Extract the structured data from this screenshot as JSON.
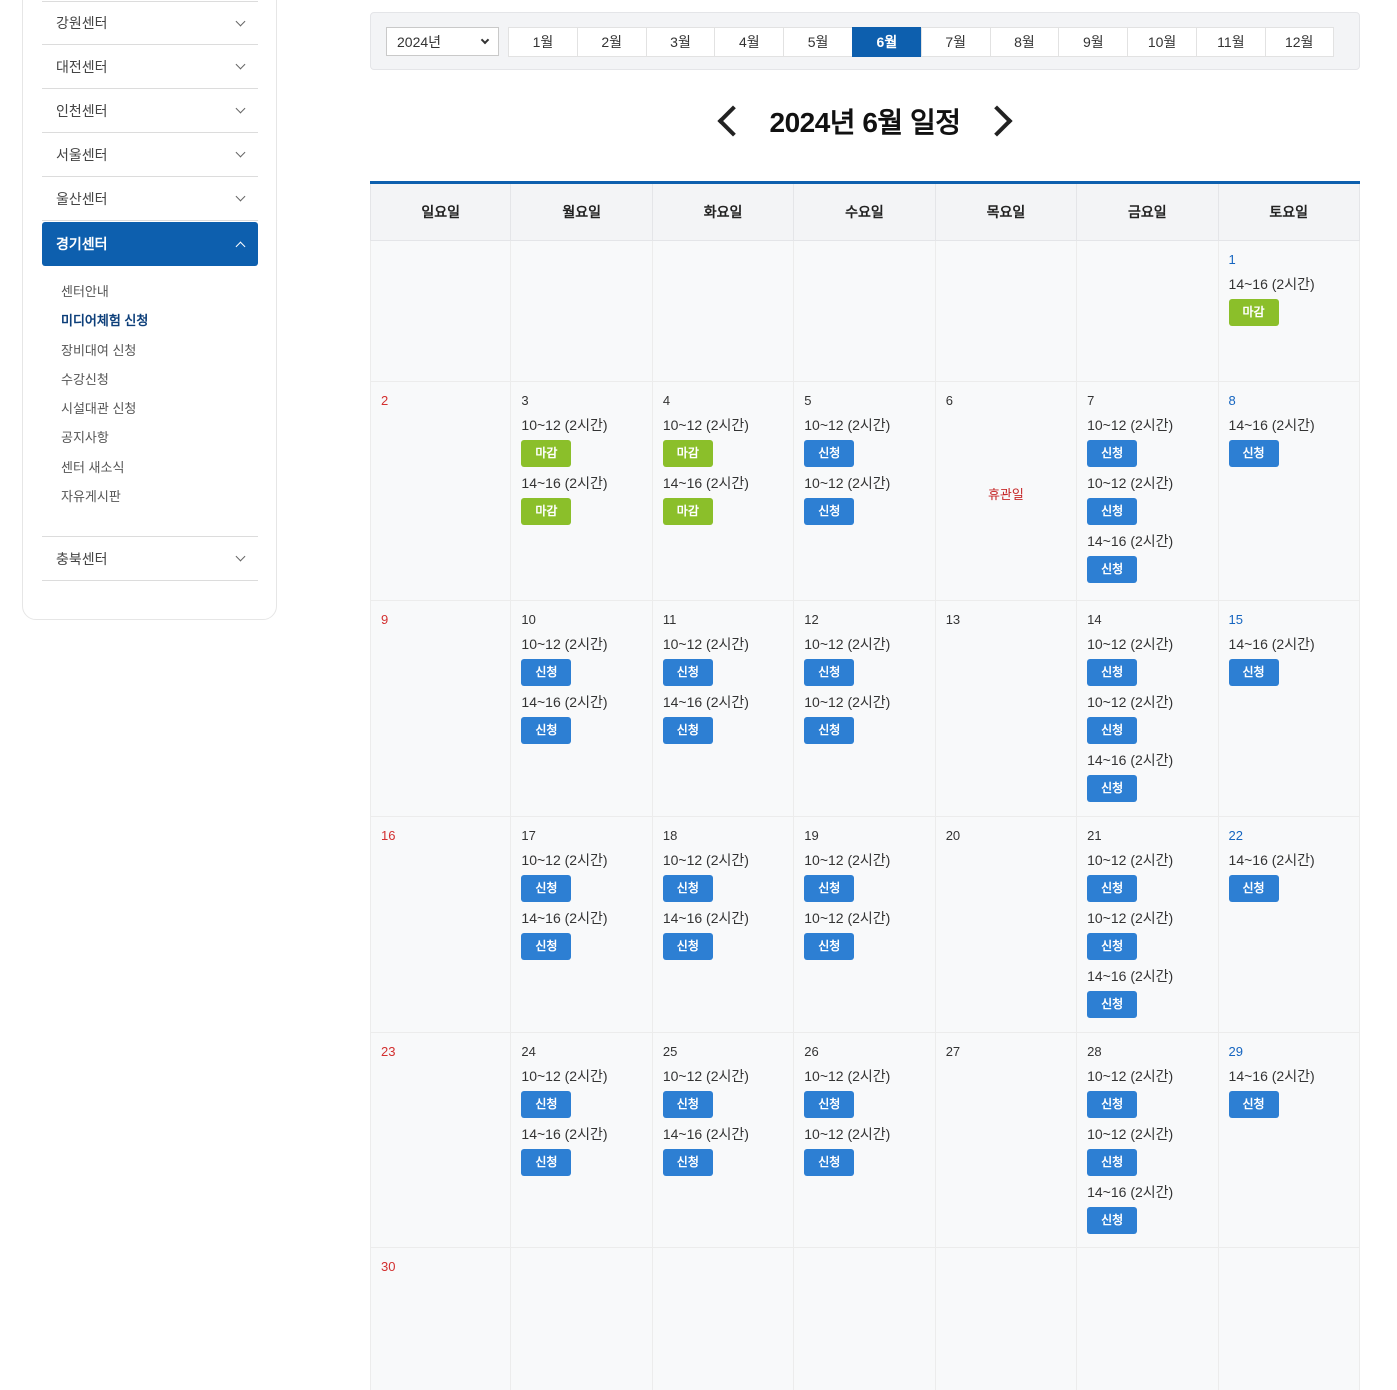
{
  "sidebar": {
    "centers_top": [
      "강원센터",
      "대전센터",
      "인천센터",
      "서울센터",
      "울산센터"
    ],
    "active_center": "경기센터",
    "sub_items": [
      "센터안내",
      "미디어체험 신청",
      "장비대여 신청",
      "수강신청",
      "시설대관 신청",
      "공지사항",
      "센터 새소식",
      "자유게시판"
    ],
    "current_sub": "미디어체험 신청",
    "centers_bottom": [
      "충북센터"
    ]
  },
  "monthbar": {
    "year": "2024년",
    "months": [
      "1월",
      "2월",
      "3월",
      "4월",
      "5월",
      "6월",
      "7월",
      "8월",
      "9월",
      "10월",
      "11월",
      "12월"
    ],
    "active_month": "6월"
  },
  "calendar": {
    "title": "2024년 6월 일정",
    "weekdays": [
      "일요일",
      "월요일",
      "화요일",
      "수요일",
      "목요일",
      "금요일",
      "토요일"
    ],
    "holiday_label": "휴관일",
    "rows": [
      {
        "height": 141,
        "cells": [
          null,
          null,
          null,
          null,
          null,
          null,
          {
            "day": "1",
            "slots": [
              {
                "time": "14~16 (2시간)",
                "status": "마감"
              }
            ]
          }
        ]
      },
      {
        "height": 219,
        "cells": [
          {
            "day": "2",
            "slots": []
          },
          {
            "day": "3",
            "slots": [
              {
                "time": "10~12 (2시간)",
                "status": "마감"
              },
              {
                "time": "14~16 (2시간)",
                "status": "마감"
              }
            ]
          },
          {
            "day": "4",
            "slots": [
              {
                "time": "10~12 (2시간)",
                "status": "마감"
              },
              {
                "time": "14~16 (2시간)",
                "status": "마감"
              }
            ]
          },
          {
            "day": "5",
            "slots": [
              {
                "time": "10~12 (2시간)",
                "status": "신청"
              },
              {
                "time": "10~12 (2시간)",
                "status": "신청"
              }
            ]
          },
          {
            "day": "6",
            "slots": [],
            "holiday": true
          },
          {
            "day": "7",
            "slots": [
              {
                "time": "10~12 (2시간)",
                "status": "신청"
              },
              {
                "time": "10~12 (2시간)",
                "status": "신청"
              },
              {
                "time": "14~16 (2시간)",
                "status": "신청"
              }
            ]
          },
          {
            "day": "8",
            "slots": [
              {
                "time": "14~16 (2시간)",
                "status": "신청"
              }
            ]
          }
        ]
      },
      {
        "height": 216,
        "cells": [
          {
            "day": "9",
            "slots": []
          },
          {
            "day": "10",
            "slots": [
              {
                "time": "10~12 (2시간)",
                "status": "신청"
              },
              {
                "time": "14~16 (2시간)",
                "status": "신청"
              }
            ]
          },
          {
            "day": "11",
            "slots": [
              {
                "time": "10~12 (2시간)",
                "status": "신청"
              },
              {
                "time": "14~16 (2시간)",
                "status": "신청"
              }
            ]
          },
          {
            "day": "12",
            "slots": [
              {
                "time": "10~12 (2시간)",
                "status": "신청"
              },
              {
                "time": "10~12 (2시간)",
                "status": "신청"
              }
            ]
          },
          {
            "day": "13",
            "slots": []
          },
          {
            "day": "14",
            "slots": [
              {
                "time": "10~12 (2시간)",
                "status": "신청"
              },
              {
                "time": "10~12 (2시간)",
                "status": "신청"
              },
              {
                "time": "14~16 (2시간)",
                "status": "신청"
              }
            ]
          },
          {
            "day": "15",
            "slots": [
              {
                "time": "14~16 (2시간)",
                "status": "신청"
              }
            ]
          }
        ]
      },
      {
        "height": 216,
        "cells": [
          {
            "day": "16",
            "slots": []
          },
          {
            "day": "17",
            "slots": [
              {
                "time": "10~12 (2시간)",
                "status": "신청"
              },
              {
                "time": "14~16 (2시간)",
                "status": "신청"
              }
            ]
          },
          {
            "day": "18",
            "slots": [
              {
                "time": "10~12 (2시간)",
                "status": "신청"
              },
              {
                "time": "14~16 (2시간)",
                "status": "신청"
              }
            ]
          },
          {
            "day": "19",
            "slots": [
              {
                "time": "10~12 (2시간)",
                "status": "신청"
              },
              {
                "time": "10~12 (2시간)",
                "status": "신청"
              }
            ]
          },
          {
            "day": "20",
            "slots": []
          },
          {
            "day": "21",
            "slots": [
              {
                "time": "10~12 (2시간)",
                "status": "신청"
              },
              {
                "time": "10~12 (2시간)",
                "status": "신청"
              },
              {
                "time": "14~16 (2시간)",
                "status": "신청"
              }
            ]
          },
          {
            "day": "22",
            "slots": [
              {
                "time": "14~16 (2시간)",
                "status": "신청"
              }
            ]
          }
        ]
      },
      {
        "height": 215,
        "cells": [
          {
            "day": "23",
            "slots": []
          },
          {
            "day": "24",
            "slots": [
              {
                "time": "10~12 (2시간)",
                "status": "신청"
              },
              {
                "time": "14~16 (2시간)",
                "status": "신청"
              }
            ]
          },
          {
            "day": "25",
            "slots": [
              {
                "time": "10~12 (2시간)",
                "status": "신청"
              },
              {
                "time": "14~16 (2시간)",
                "status": "신청"
              }
            ]
          },
          {
            "day": "26",
            "slots": [
              {
                "time": "10~12 (2시간)",
                "status": "신청"
              },
              {
                "time": "10~12 (2시간)",
                "status": "신청"
              }
            ]
          },
          {
            "day": "27",
            "slots": []
          },
          {
            "day": "28",
            "slots": [
              {
                "time": "10~12 (2시간)",
                "status": "신청"
              },
              {
                "time": "10~12 (2시간)",
                "status": "신청"
              },
              {
                "time": "14~16 (2시간)",
                "status": "신청"
              }
            ]
          },
          {
            "day": "29",
            "slots": [
              {
                "time": "14~16 (2시간)",
                "status": "신청"
              }
            ]
          }
        ]
      },
      {
        "height": 143,
        "cells": [
          {
            "day": "30",
            "slots": []
          },
          null,
          null,
          null,
          null,
          null,
          null
        ]
      }
    ]
  },
  "colors": {
    "primary": "#0d5fae",
    "apply_button": "#2d7fd3",
    "closed_button": "#8bbf2a",
    "sunday": "#d32f2f",
    "saturday": "#1565c0"
  }
}
